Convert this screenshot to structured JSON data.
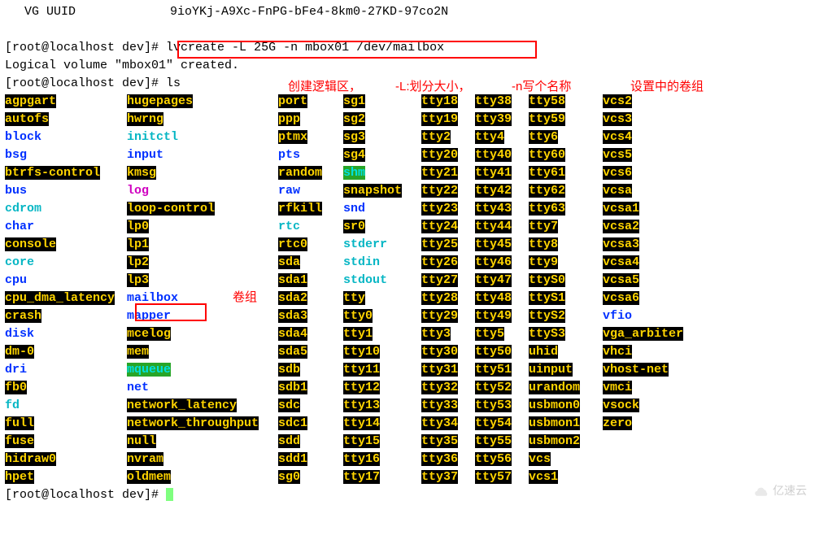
{
  "header": {
    "vg_label": "VG UUID",
    "vg_uuid": "9ioYKj-A9Xc-FnPG-bFe4-8km0-27KD-97co2N"
  },
  "lines": {
    "prompt1": "[root@localhost dev]# ",
    "cmd1": "lvcreate -L 25G -n mbox01 /dev/mailbox",
    "created": "  Logical volume \"mbox01\" created.",
    "prompt2": "[root@localhost dev]# ",
    "cmd2": "ls",
    "prompt3": "[root@localhost dev]# "
  },
  "labels": {
    "a1": "创建逻辑区，",
    "a2": "-L:划分大小，",
    "a3": "-n写个名称",
    "a4": "设置中的卷组",
    "volgroup": "卷组"
  },
  "watermark": "亿速云",
  "listing": [
    [
      {
        "t": "agpgart",
        "s": "hl-y"
      },
      {
        "t": "hugepages",
        "s": "hl-y"
      },
      {
        "t": "port",
        "s": "hl-y"
      },
      {
        "t": "sg1",
        "s": "hl-y"
      },
      {
        "t": "tty18",
        "s": "hl-y"
      },
      {
        "t": "tty38",
        "s": "hl-y"
      },
      {
        "t": "tty58",
        "s": "hl-y"
      },
      {
        "t": "vcs2",
        "s": "hl-y"
      }
    ],
    [
      {
        "t": "autofs",
        "s": "hl-y"
      },
      {
        "t": "hwrng",
        "s": "hl-y"
      },
      {
        "t": "ppp",
        "s": "hl-y"
      },
      {
        "t": "sg2",
        "s": "hl-y"
      },
      {
        "t": "tty19",
        "s": "hl-y"
      },
      {
        "t": "tty39",
        "s": "hl-y"
      },
      {
        "t": "tty59",
        "s": "hl-y"
      },
      {
        "t": "vcs3",
        "s": "hl-y"
      }
    ],
    [
      {
        "t": "block",
        "s": "b-blue"
      },
      {
        "t": "initctl",
        "s": "b-cyan"
      },
      {
        "t": "ptmx",
        "s": "hl-y"
      },
      {
        "t": "sg3",
        "s": "hl-y"
      },
      {
        "t": "tty2",
        "s": "hl-y"
      },
      {
        "t": "tty4",
        "s": "hl-y"
      },
      {
        "t": "tty6",
        "s": "hl-y"
      },
      {
        "t": "vcs4",
        "s": "hl-y"
      }
    ],
    [
      {
        "t": "bsg",
        "s": "b-blue"
      },
      {
        "t": "input",
        "s": "b-blue"
      },
      {
        "t": "pts",
        "s": "b-blue"
      },
      {
        "t": "sg4",
        "s": "hl-y"
      },
      {
        "t": "tty20",
        "s": "hl-y"
      },
      {
        "t": "tty40",
        "s": "hl-y"
      },
      {
        "t": "tty60",
        "s": "hl-y"
      },
      {
        "t": "vcs5",
        "s": "hl-y"
      }
    ],
    [
      {
        "t": "btrfs-control",
        "s": "hl-y"
      },
      {
        "t": "kmsg",
        "s": "hl-y"
      },
      {
        "t": "random",
        "s": "hl-y"
      },
      {
        "t": "shm",
        "s": "hl-g"
      },
      {
        "t": "tty21",
        "s": "hl-y"
      },
      {
        "t": "tty41",
        "s": "hl-y"
      },
      {
        "t": "tty61",
        "s": "hl-y"
      },
      {
        "t": "vcs6",
        "s": "hl-y"
      }
    ],
    [
      {
        "t": "bus",
        "s": "b-blue"
      },
      {
        "t": "log",
        "s": "b-mag"
      },
      {
        "t": "raw",
        "s": "b-blue"
      },
      {
        "t": "snapshot",
        "s": "hl-y"
      },
      {
        "t": "tty22",
        "s": "hl-y"
      },
      {
        "t": "tty42",
        "s": "hl-y"
      },
      {
        "t": "tty62",
        "s": "hl-y"
      },
      {
        "t": "vcsa",
        "s": "hl-y"
      }
    ],
    [
      {
        "t": "cdrom",
        "s": "b-cyan"
      },
      {
        "t": "loop-control",
        "s": "hl-y"
      },
      {
        "t": "rfkill",
        "s": "hl-y"
      },
      {
        "t": "snd",
        "s": "b-blue"
      },
      {
        "t": "tty23",
        "s": "hl-y"
      },
      {
        "t": "tty43",
        "s": "hl-y"
      },
      {
        "t": "tty63",
        "s": "hl-y"
      },
      {
        "t": "vcsa1",
        "s": "hl-y"
      }
    ],
    [
      {
        "t": "char",
        "s": "b-blue"
      },
      {
        "t": "lp0",
        "s": "hl-y"
      },
      {
        "t": "rtc",
        "s": "b-cyan"
      },
      {
        "t": "sr0",
        "s": "hl-y"
      },
      {
        "t": "tty24",
        "s": "hl-y"
      },
      {
        "t": "tty44",
        "s": "hl-y"
      },
      {
        "t": "tty7",
        "s": "hl-y"
      },
      {
        "t": "vcsa2",
        "s": "hl-y"
      }
    ],
    [
      {
        "t": "console",
        "s": "hl-y"
      },
      {
        "t": "lp1",
        "s": "hl-y"
      },
      {
        "t": "rtc0",
        "s": "hl-y"
      },
      {
        "t": "stderr",
        "s": "b-cyan"
      },
      {
        "t": "tty25",
        "s": "hl-y"
      },
      {
        "t": "tty45",
        "s": "hl-y"
      },
      {
        "t": "tty8",
        "s": "hl-y"
      },
      {
        "t": "vcsa3",
        "s": "hl-y"
      }
    ],
    [
      {
        "t": "core",
        "s": "b-cyan"
      },
      {
        "t": "lp2",
        "s": "hl-y"
      },
      {
        "t": "sda",
        "s": "hl-y"
      },
      {
        "t": "stdin",
        "s": "b-cyan"
      },
      {
        "t": "tty26",
        "s": "hl-y"
      },
      {
        "t": "tty46",
        "s": "hl-y"
      },
      {
        "t": "tty9",
        "s": "hl-y"
      },
      {
        "t": "vcsa4",
        "s": "hl-y"
      }
    ],
    [
      {
        "t": "cpu",
        "s": "b-blue"
      },
      {
        "t": "lp3",
        "s": "hl-y"
      },
      {
        "t": "sda1",
        "s": "hl-y"
      },
      {
        "t": "stdout",
        "s": "b-cyan"
      },
      {
        "t": "tty27",
        "s": "hl-y"
      },
      {
        "t": "tty47",
        "s": "hl-y"
      },
      {
        "t": "ttyS0",
        "s": "hl-y"
      },
      {
        "t": "vcsa5",
        "s": "hl-y"
      }
    ],
    [
      {
        "t": "cpu_dma_latency",
        "s": "hl-y"
      },
      {
        "t": "mailbox",
        "s": "b-blue"
      },
      {
        "t": "sda2",
        "s": "hl-y"
      },
      {
        "t": "tty",
        "s": "hl-y"
      },
      {
        "t": "tty28",
        "s": "hl-y"
      },
      {
        "t": "tty48",
        "s": "hl-y"
      },
      {
        "t": "ttyS1",
        "s": "hl-y"
      },
      {
        "t": "vcsa6",
        "s": "hl-y"
      }
    ],
    [
      {
        "t": "crash",
        "s": "hl-y"
      },
      {
        "t": "mapper",
        "s": "b-blue"
      },
      {
        "t": "sda3",
        "s": "hl-y"
      },
      {
        "t": "tty0",
        "s": "hl-y"
      },
      {
        "t": "tty29",
        "s": "hl-y"
      },
      {
        "t": "tty49",
        "s": "hl-y"
      },
      {
        "t": "ttyS2",
        "s": "hl-y"
      },
      {
        "t": "vfio",
        "s": "b-blue"
      }
    ],
    [
      {
        "t": "disk",
        "s": "b-blue"
      },
      {
        "t": "mcelog",
        "s": "hl-y"
      },
      {
        "t": "sda4",
        "s": "hl-y"
      },
      {
        "t": "tty1",
        "s": "hl-y"
      },
      {
        "t": "tty3",
        "s": "hl-y"
      },
      {
        "t": "tty5",
        "s": "hl-y"
      },
      {
        "t": "ttyS3",
        "s": "hl-y"
      },
      {
        "t": "vga_arbiter",
        "s": "hl-y"
      }
    ],
    [
      {
        "t": "dm-0",
        "s": "hl-y"
      },
      {
        "t": "mem",
        "s": "hl-y"
      },
      {
        "t": "sda5",
        "s": "hl-y"
      },
      {
        "t": "tty10",
        "s": "hl-y"
      },
      {
        "t": "tty30",
        "s": "hl-y"
      },
      {
        "t": "tty50",
        "s": "hl-y"
      },
      {
        "t": "uhid",
        "s": "hl-y"
      },
      {
        "t": "vhci",
        "s": "hl-y"
      }
    ],
    [
      {
        "t": "dri",
        "s": "b-blue"
      },
      {
        "t": "mqueue",
        "s": "hl-g"
      },
      {
        "t": "sdb",
        "s": "hl-y"
      },
      {
        "t": "tty11",
        "s": "hl-y"
      },
      {
        "t": "tty31",
        "s": "hl-y"
      },
      {
        "t": "tty51",
        "s": "hl-y"
      },
      {
        "t": "uinput",
        "s": "hl-y"
      },
      {
        "t": "vhost-net",
        "s": "hl-y"
      }
    ],
    [
      {
        "t": "fb0",
        "s": "hl-y"
      },
      {
        "t": "net",
        "s": "b-blue"
      },
      {
        "t": "sdb1",
        "s": "hl-y"
      },
      {
        "t": "tty12",
        "s": "hl-y"
      },
      {
        "t": "tty32",
        "s": "hl-y"
      },
      {
        "t": "tty52",
        "s": "hl-y"
      },
      {
        "t": "urandom",
        "s": "hl-y"
      },
      {
        "t": "vmci",
        "s": "hl-y"
      }
    ],
    [
      {
        "t": "fd",
        "s": "b-cyan"
      },
      {
        "t": "network_latency",
        "s": "hl-y"
      },
      {
        "t": "sdc",
        "s": "hl-y"
      },
      {
        "t": "tty13",
        "s": "hl-y"
      },
      {
        "t": "tty33",
        "s": "hl-y"
      },
      {
        "t": "tty53",
        "s": "hl-y"
      },
      {
        "t": "usbmon0",
        "s": "hl-y"
      },
      {
        "t": "vsock",
        "s": "hl-y"
      }
    ],
    [
      {
        "t": "full",
        "s": "hl-y"
      },
      {
        "t": "network_throughput",
        "s": "hl-y"
      },
      {
        "t": "sdc1",
        "s": "hl-y"
      },
      {
        "t": "tty14",
        "s": "hl-y"
      },
      {
        "t": "tty34",
        "s": "hl-y"
      },
      {
        "t": "tty54",
        "s": "hl-y"
      },
      {
        "t": "usbmon1",
        "s": "hl-y"
      },
      {
        "t": "zero",
        "s": "hl-y"
      }
    ],
    [
      {
        "t": "fuse",
        "s": "hl-y"
      },
      {
        "t": "null",
        "s": "hl-y"
      },
      {
        "t": "sdd",
        "s": "hl-y"
      },
      {
        "t": "tty15",
        "s": "hl-y"
      },
      {
        "t": "tty35",
        "s": "hl-y"
      },
      {
        "t": "tty55",
        "s": "hl-y"
      },
      {
        "t": "usbmon2",
        "s": "hl-y"
      },
      {
        "t": "",
        "s": "plain"
      }
    ],
    [
      {
        "t": "hidraw0",
        "s": "hl-y"
      },
      {
        "t": "nvram",
        "s": "hl-y"
      },
      {
        "t": "sdd1",
        "s": "hl-y"
      },
      {
        "t": "tty16",
        "s": "hl-y"
      },
      {
        "t": "tty36",
        "s": "hl-y"
      },
      {
        "t": "tty56",
        "s": "hl-y"
      },
      {
        "t": "vcs",
        "s": "hl-y"
      },
      {
        "t": "",
        "s": "plain"
      }
    ],
    [
      {
        "t": "hpet",
        "s": "hl-y"
      },
      {
        "t": "oldmem",
        "s": "hl-y"
      },
      {
        "t": "sg0",
        "s": "hl-y"
      },
      {
        "t": "tty17",
        "s": "hl-y"
      },
      {
        "t": "tty37",
        "s": "hl-y"
      },
      {
        "t": "tty57",
        "s": "hl-y"
      },
      {
        "t": "vcs1",
        "s": "hl-y"
      },
      {
        "t": "",
        "s": "plain"
      }
    ]
  ]
}
